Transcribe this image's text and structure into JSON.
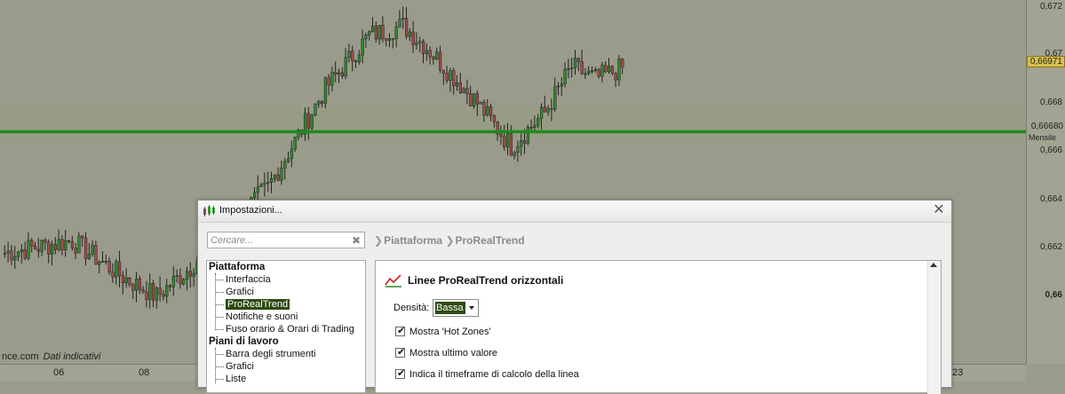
{
  "chart": {
    "price_levels": [
      "0,672",
      "0,67",
      "0,668",
      "0,666",
      "0,664",
      "0,662",
      "0,66"
    ],
    "current_price": "0,66971",
    "line_price": "0,66680",
    "line_period": "Mensile",
    "time_labels": [
      "06",
      "08",
      "23"
    ],
    "source_text": "nce.com",
    "source_note": "Dati indicativi",
    "colors": {
      "background": "#9b9b8b",
      "up_candle": "#2f8a2f",
      "down_candle": "#a24a4a",
      "horizontal_line": "#1f8a1f",
      "current_price_tag": "#d8c04a"
    }
  },
  "dialog": {
    "title": "Impostazioni...",
    "search_placeholder": "Cercare...",
    "breadcrumb": [
      "Piattaforma",
      "ProRealTrend"
    ],
    "tree": [
      {
        "label": "Piattaforma",
        "children": [
          "Interfaccia",
          "Grafici",
          "ProRealTrend",
          "Notifiche e suoni",
          "Fuso orario & Orari di Trading"
        ]
      },
      {
        "label": "Piani di lavoro",
        "children": [
          "Barra degli strumenti",
          "Grafici",
          "Liste"
        ]
      }
    ],
    "selected_item": "ProRealTrend",
    "content": {
      "section_title": "Linee ProRealTrend orizzontali",
      "density_label": "Densità:",
      "density_value": "Bassa",
      "checkboxes": [
        {
          "label": "Mostra 'Hot Zones'",
          "checked": true
        },
        {
          "label": "Mostra ultimo valore",
          "checked": true
        },
        {
          "label": "Indica il timeframe di calcolo della linea",
          "checked": true
        }
      ]
    }
  }
}
